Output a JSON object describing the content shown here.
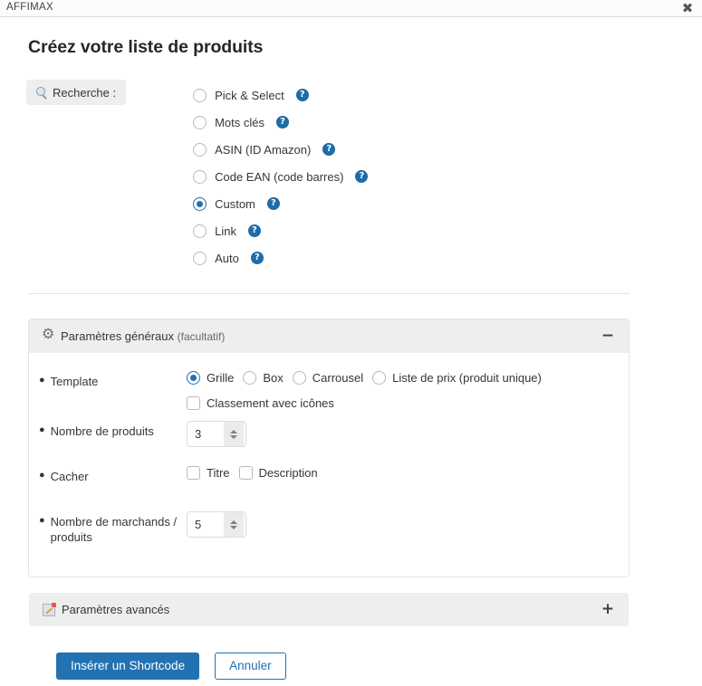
{
  "window": {
    "title": "AFFIMAX",
    "close_label": "✖"
  },
  "page": {
    "heading": "Créez votre liste de produits"
  },
  "search": {
    "label": "Recherche :",
    "icon": "search-icon",
    "options": [
      {
        "label": "Pick & Select",
        "checked": false,
        "help": "?"
      },
      {
        "label": "Mots clés",
        "checked": false,
        "help": "?"
      },
      {
        "label": "ASIN (ID Amazon)",
        "checked": false,
        "help": "?"
      },
      {
        "label": "Code EAN (code barres)",
        "checked": false,
        "help": "?"
      },
      {
        "label": "Custom",
        "checked": true,
        "help": "?"
      },
      {
        "label": "Link",
        "checked": false,
        "help": "?"
      },
      {
        "label": "Auto",
        "checked": false,
        "help": "?"
      }
    ]
  },
  "general_panel": {
    "icon": "gear-icon",
    "title": "Paramètres généraux",
    "optional": "(facultatif)",
    "toggle": "−",
    "expanded": true,
    "rows": {
      "template": {
        "label": "Template",
        "options": [
          {
            "label": "Grille",
            "checked": true
          },
          {
            "label": "Box",
            "checked": false
          },
          {
            "label": "Carrousel",
            "checked": false
          },
          {
            "label": "Liste de prix (produit unique)",
            "checked": false
          }
        ],
        "checkbox": {
          "label": "Classement avec icônes",
          "checked": false
        }
      },
      "product_count": {
        "label": "Nombre de produits",
        "value": "3"
      },
      "hide": {
        "label": "Cacher",
        "options": [
          {
            "label": "Titre",
            "checked": false
          },
          {
            "label": "Description",
            "checked": false
          }
        ]
      },
      "merchant_count": {
        "label": "Nombre de marchands / produits",
        "value": "5"
      }
    }
  },
  "advanced_panel": {
    "icon": "memo-icon",
    "title": "Paramètres avancés",
    "toggle": "+",
    "expanded": false
  },
  "footer": {
    "primary": "Insérer un Shortcode",
    "secondary": "Annuler"
  },
  "colors": {
    "accent": "#2271b1",
    "help_badge": "#1d6ca8",
    "panel_header": "#eeeeee",
    "text": "#32373c"
  }
}
